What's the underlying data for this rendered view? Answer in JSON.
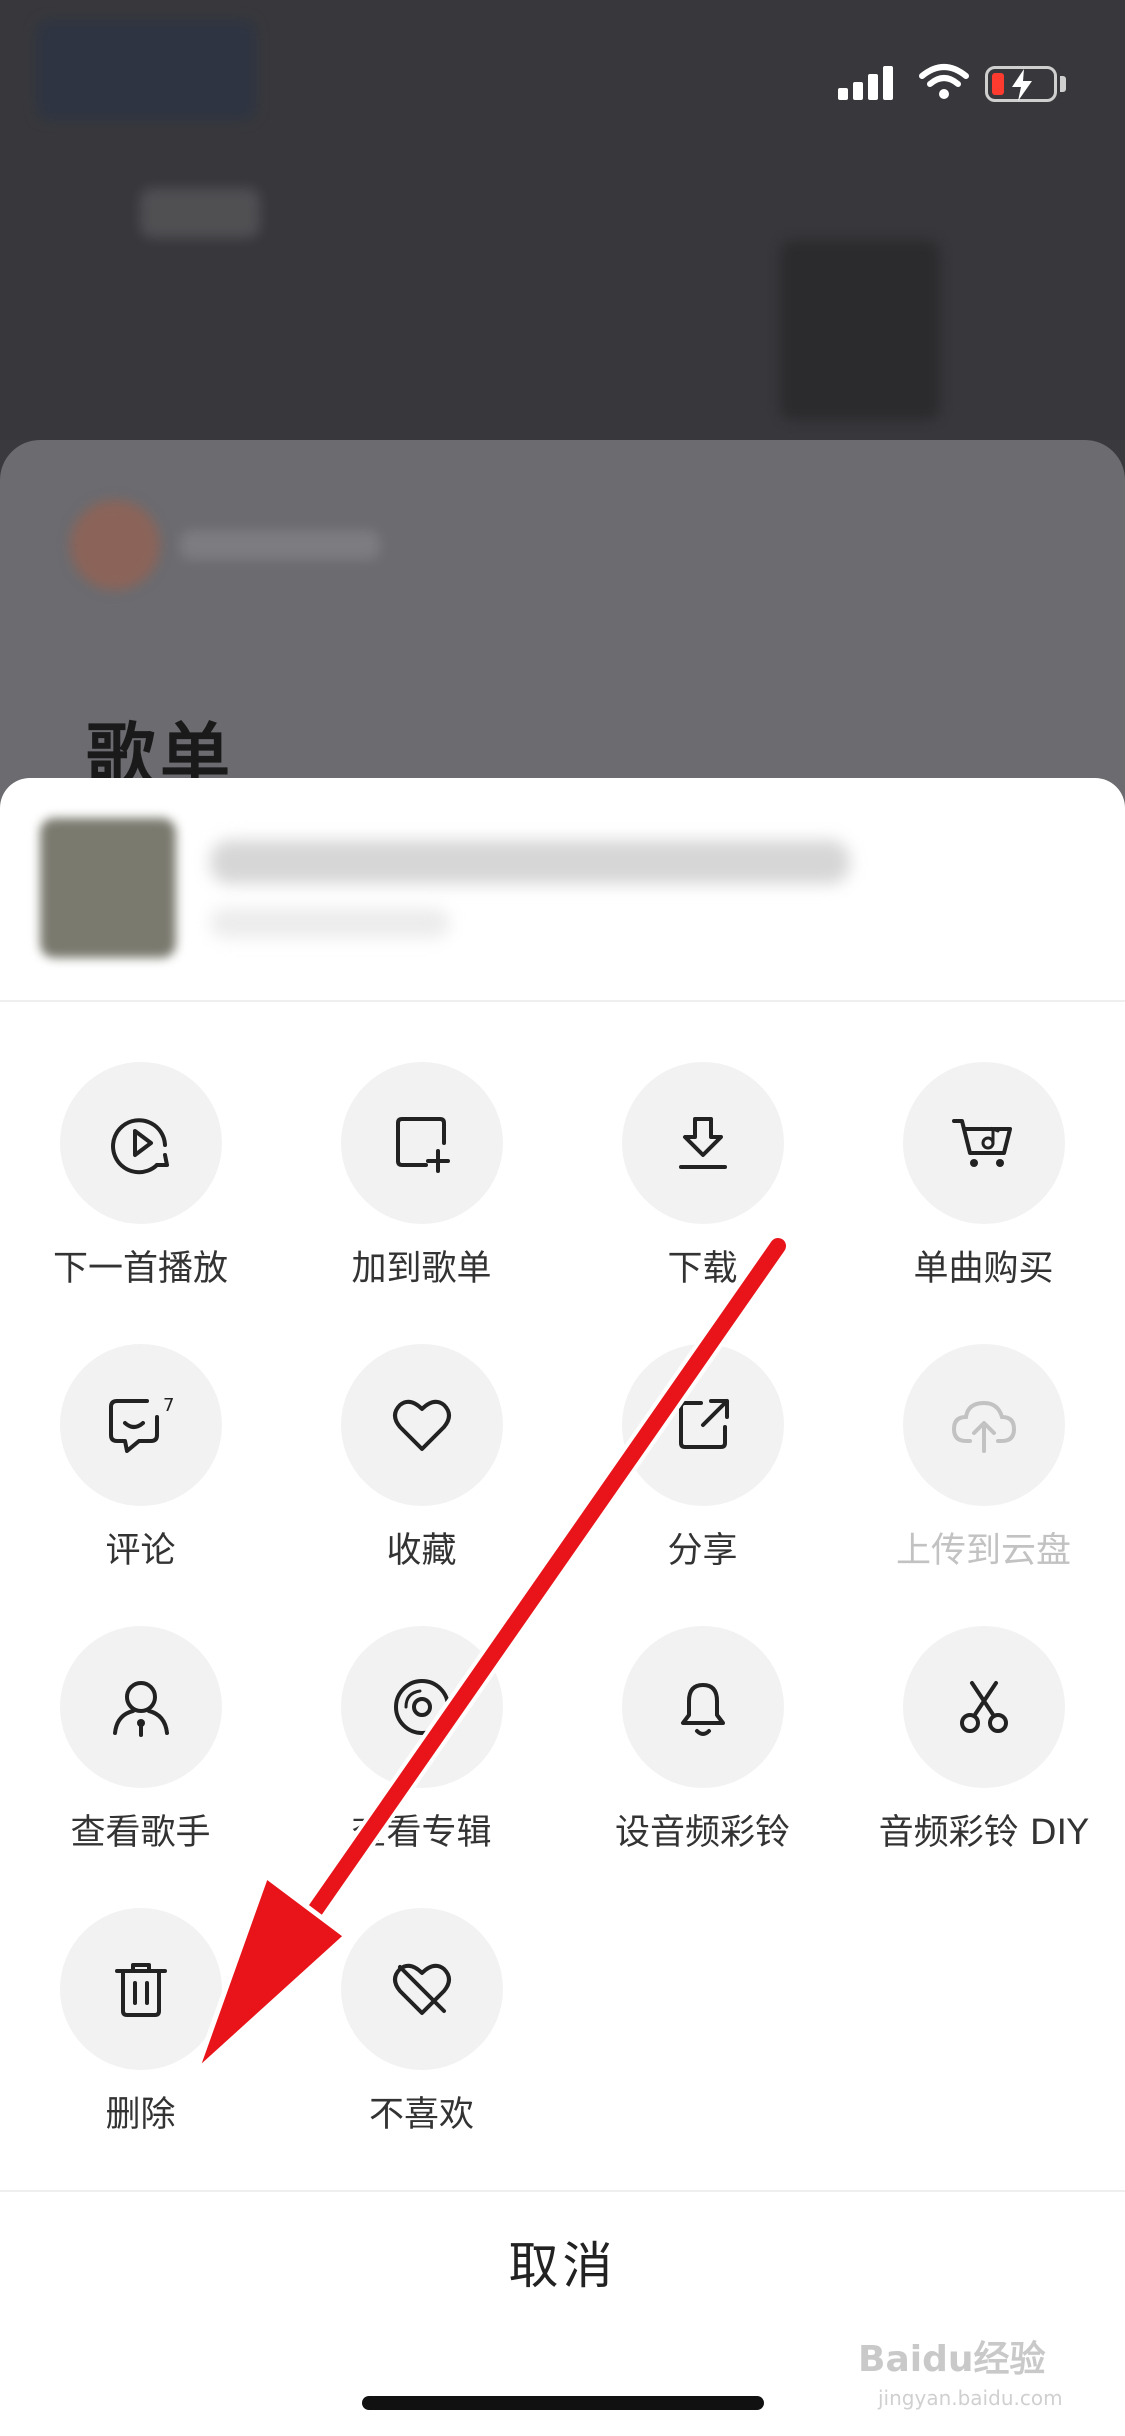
{
  "status_bar": {
    "signal_icon": "cellular-signal-icon",
    "wifi_icon": "wifi-icon",
    "battery_icon": "battery-charging-icon",
    "battery_color": "#ff3b30"
  },
  "background": {
    "section_title": "歌单"
  },
  "sheet": {
    "actions": [
      {
        "label": "下一首播放",
        "icon": "play-next-icon",
        "enabled": true
      },
      {
        "label": "加到歌单",
        "icon": "add-to-playlist-icon",
        "enabled": true
      },
      {
        "label": "下载",
        "icon": "download-icon",
        "enabled": true
      },
      {
        "label": "单曲购买",
        "icon": "cart-icon",
        "enabled": true
      },
      {
        "label": "评论",
        "icon": "comment-icon",
        "badge": "7",
        "enabled": true
      },
      {
        "label": "收藏",
        "icon": "heart-icon",
        "enabled": true
      },
      {
        "label": "分享",
        "icon": "share-icon",
        "enabled": true
      },
      {
        "label": "上传到云盘",
        "icon": "cloud-upload-icon",
        "enabled": false
      },
      {
        "label": "查看歌手",
        "icon": "singer-icon",
        "enabled": true
      },
      {
        "label": "查看专辑",
        "icon": "album-icon",
        "enabled": true
      },
      {
        "label": "设音频彩铃",
        "icon": "bell-icon",
        "enabled": true
      },
      {
        "label": "音频彩铃 DIY",
        "icon": "scissors-icon",
        "enabled": true
      },
      {
        "label": "删除",
        "icon": "trash-icon",
        "enabled": true
      },
      {
        "label": "不喜欢",
        "icon": "dislike-icon",
        "enabled": true
      }
    ],
    "cancel_label": "取消"
  },
  "annotation": {
    "arrow_color": "#e8141a"
  },
  "watermark": {
    "brand": "Baidu经验",
    "url": "jingyan.baidu.com"
  }
}
